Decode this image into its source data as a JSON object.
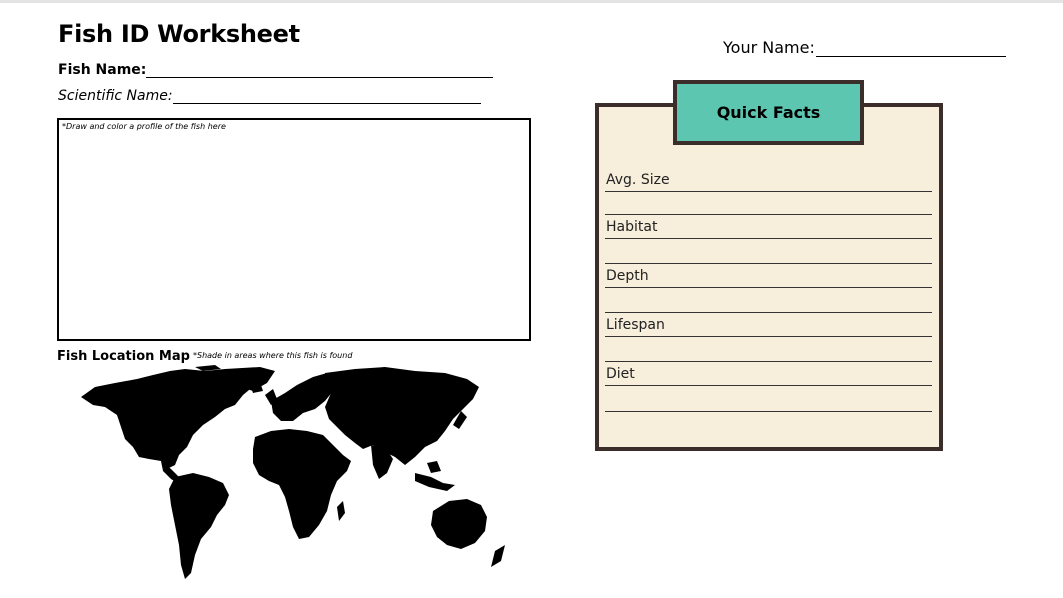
{
  "worksheet": {
    "title": "Fish ID Worksheet",
    "your_name_label": "Your Name:",
    "fish_name_label": "Fish Name:",
    "scientific_name_label": "Scientific Name:",
    "draw_hint": "*Draw and color a profile of the fish here",
    "map_title": "Fish Location Map",
    "map_hint": "*Shade in areas where this fish is found"
  },
  "quick_facts": {
    "title": "Quick Facts",
    "labels": [
      "Avg. Size",
      "Habitat",
      "Depth",
      "Lifespan",
      "Diet"
    ],
    "card_color": "#f7eedb",
    "tab_color": "#5cc6b1",
    "border_color": "#3a2d2a"
  }
}
